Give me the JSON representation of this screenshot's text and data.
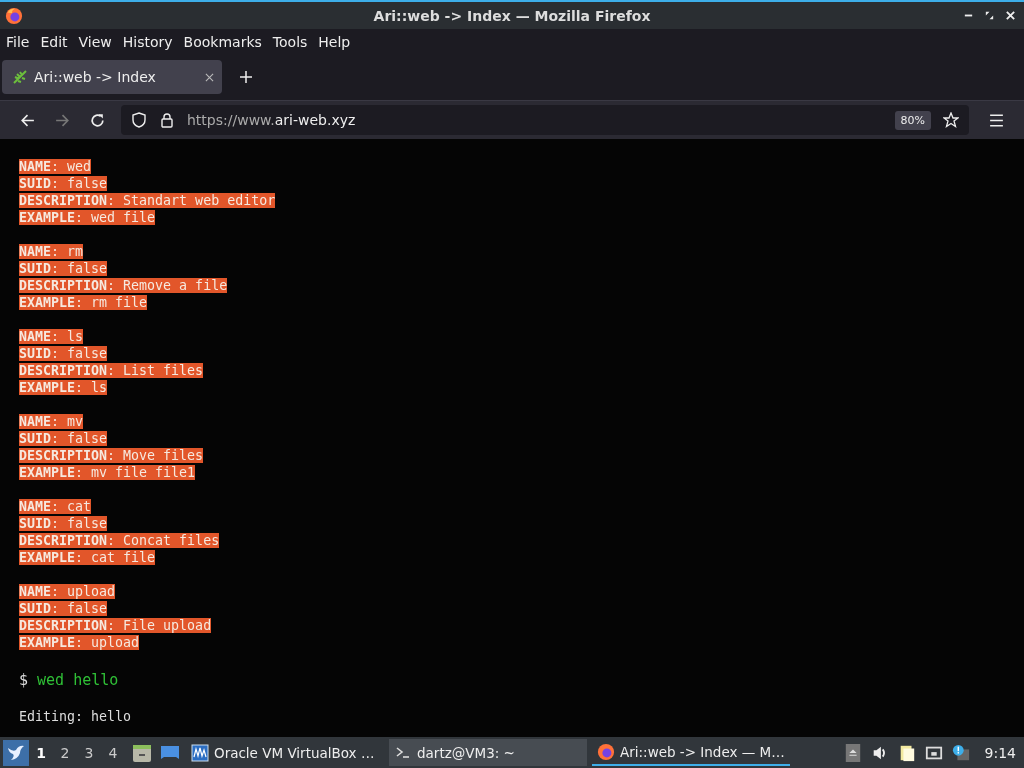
{
  "window": {
    "title": "Ari::web -> Index — Mozilla Firefox"
  },
  "menu": [
    "File",
    "Edit",
    "View",
    "History",
    "Bookmarks",
    "Tools",
    "Help"
  ],
  "tabs": [
    {
      "label": "Ari::web -> Index",
      "selected": true
    }
  ],
  "address_bar": {
    "url_prefix": "https://www.",
    "url_domain": "ari-web.xyz",
    "zoom": "80%"
  },
  "terminal": {
    "entries": [
      [
        "**NAME**: wed",
        "**SUID**: false",
        "**DESCRIPTION**: Standart web editor",
        "**EXAMPLE**: wed file"
      ],
      [
        "**NAME**: rm",
        "**SUID**: false",
        "**DESCRIPTION**: Remove a file",
        "**EXAMPLE**: rm file"
      ],
      [
        "**NAME**: ls",
        "**SUID**: false",
        "**DESCRIPTION**: List files",
        "**EXAMPLE**: ls"
      ],
      [
        "**NAME**: mv",
        "**SUID**: false",
        "**DESCRIPTION**: Move files",
        "**EXAMPLE**: mv file file1"
      ],
      [
        "**NAME**: cat",
        "**SUID**: false",
        "**DESCRIPTION**: Concat files",
        "**EXAMPLE**: cat file"
      ],
      [
        "**NAME**: upload",
        "**SUID**: false",
        "**DESCRIPTION**: File upload",
        "**EXAMPLE**: upload"
      ]
    ],
    "prompt": "$",
    "command": "wed hello",
    "output": "Editing: hello"
  },
  "taskbar": {
    "workspaces": [
      {
        "label": "1",
        "selected": true
      },
      {
        "label": "2",
        "selected": false
      },
      {
        "label": "3",
        "selected": false
      },
      {
        "label": "4",
        "selected": false
      }
    ],
    "tasks": [
      {
        "kind": "virtualbox",
        "label": "Oracle VM VirtualBox …",
        "selected": false,
        "highlighted": false
      },
      {
        "kind": "terminal",
        "label": "dartz@VM3: ~",
        "selected": false,
        "highlighted": true
      },
      {
        "kind": "firefox",
        "label": "Ari::web -> Index — M…",
        "selected": true,
        "highlighted": false
      }
    ],
    "clock": "9:14"
  }
}
